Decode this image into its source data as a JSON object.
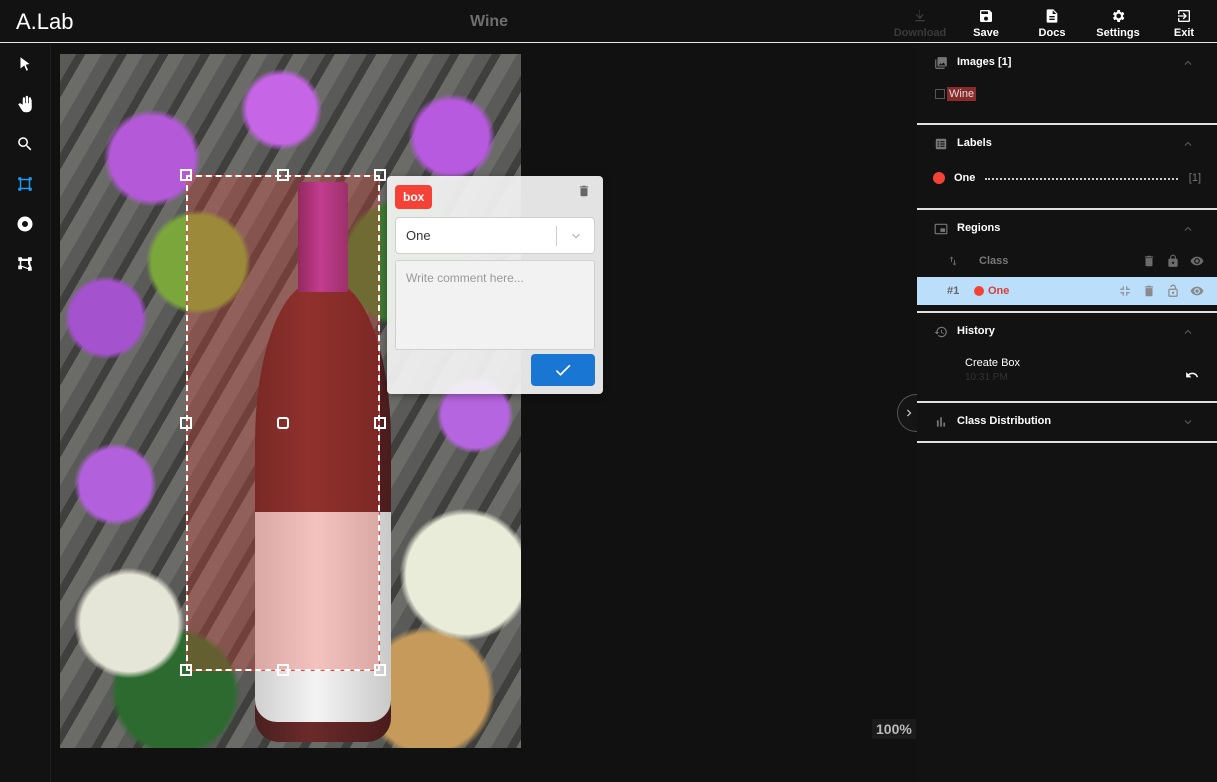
{
  "app": {
    "brand": "A.Lab",
    "title": "Wine"
  },
  "header_buttons": {
    "download": "Download",
    "save": "Save",
    "docs": "Docs",
    "settings": "Settings",
    "exit": "Exit"
  },
  "tools": [
    "select-icon",
    "pan-icon",
    "zoom-icon",
    "box-icon",
    "point-icon",
    "polygon-icon"
  ],
  "region_editor": {
    "tag": "box",
    "class_value": "One",
    "comment_placeholder": "Write comment here..."
  },
  "canvas": {
    "zoom": "100%"
  },
  "sidebar": {
    "images": {
      "title": "Images [1]",
      "items": [
        {
          "name": "Wine"
        }
      ]
    },
    "labels": {
      "title": "Labels",
      "items": [
        {
          "name": "One",
          "count": "[1]",
          "color": "#f44336"
        }
      ]
    },
    "regions": {
      "title": "Regions",
      "column": "Class",
      "items": [
        {
          "id": "#1",
          "class": "One",
          "color": "#f44336"
        }
      ]
    },
    "history": {
      "title": "History",
      "items": [
        {
          "action": "Create Box",
          "time": "10:31 PM"
        }
      ]
    },
    "class_distribution": {
      "title": "Class Distribution"
    }
  },
  "colors": {
    "accent": "#2196f3",
    "region": "#f44336",
    "selected_row": "#bbdefb"
  }
}
